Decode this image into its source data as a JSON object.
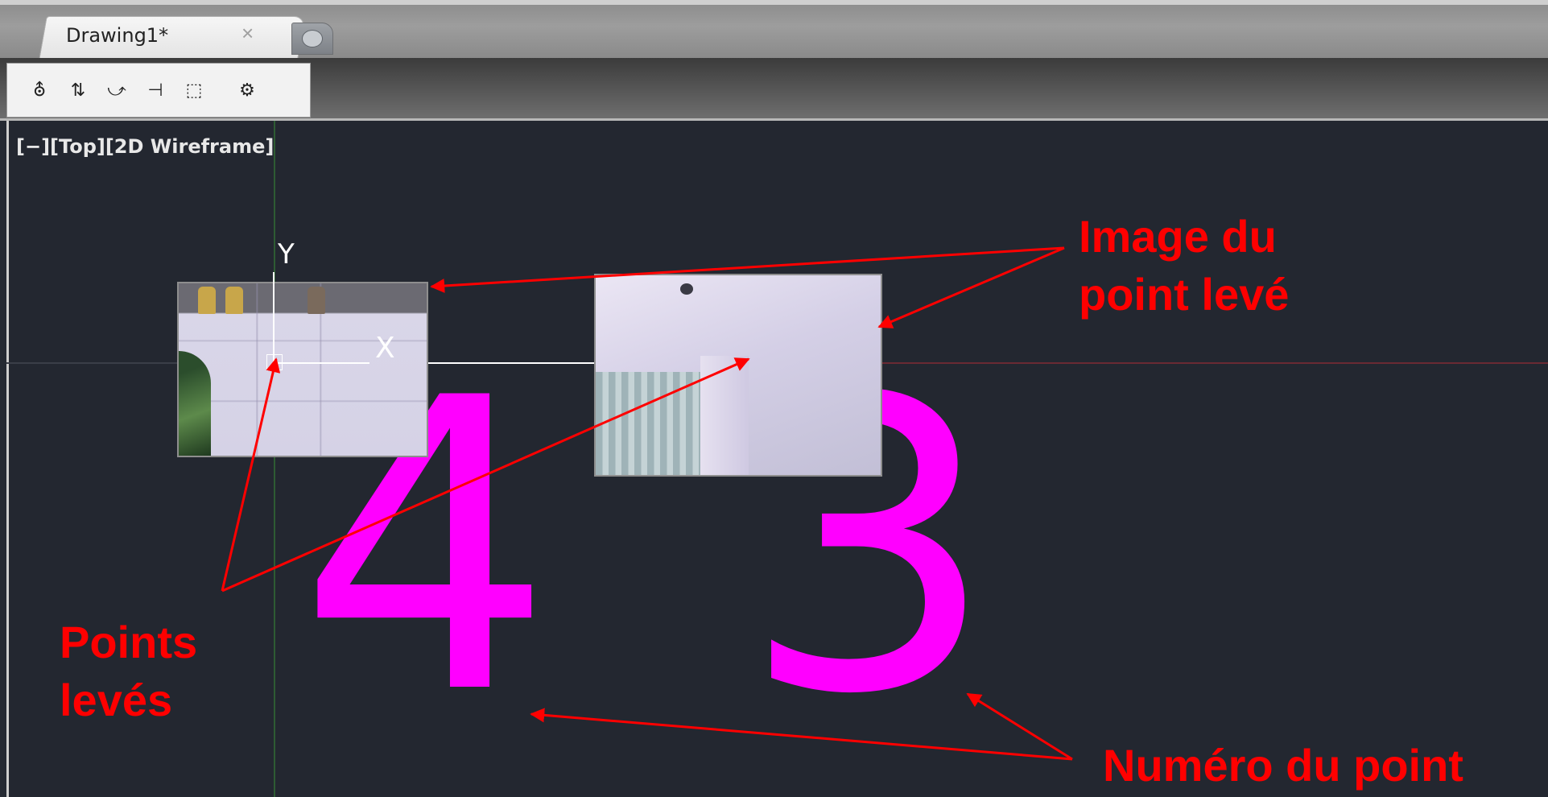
{
  "tabbar": {
    "active_tab_label": "Drawing1*",
    "close_icon": "×"
  },
  "toolbar": {
    "tools": [
      {
        "name": "survey-point-tool-icon",
        "glyph": "⛢"
      },
      {
        "name": "move-point-tool-icon",
        "glyph": "⇅"
      },
      {
        "name": "link-tool-icon",
        "glyph": "⤻"
      },
      {
        "name": "intersect-tool-icon",
        "glyph": "⊣"
      },
      {
        "name": "rectangle-select-tool-icon",
        "glyph": "⬚"
      },
      {
        "name": "settings-gear-icon",
        "glyph": "⚙"
      }
    ]
  },
  "viewport": {
    "label": "[−][Top][2D Wireframe]",
    "ucs_y": "Y",
    "ucs_x": "X",
    "point_numbers": [
      "4",
      "3"
    ]
  },
  "annotations": {
    "image_du_point_leve": [
      "Image du",
      "point levé"
    ],
    "points_leves": [
      "Points",
      "levés"
    ],
    "numero_du_point": "Numéro du point"
  },
  "colors": {
    "annotation": "#ff0000",
    "point_number": "#ff00ff",
    "background": "#232730"
  }
}
